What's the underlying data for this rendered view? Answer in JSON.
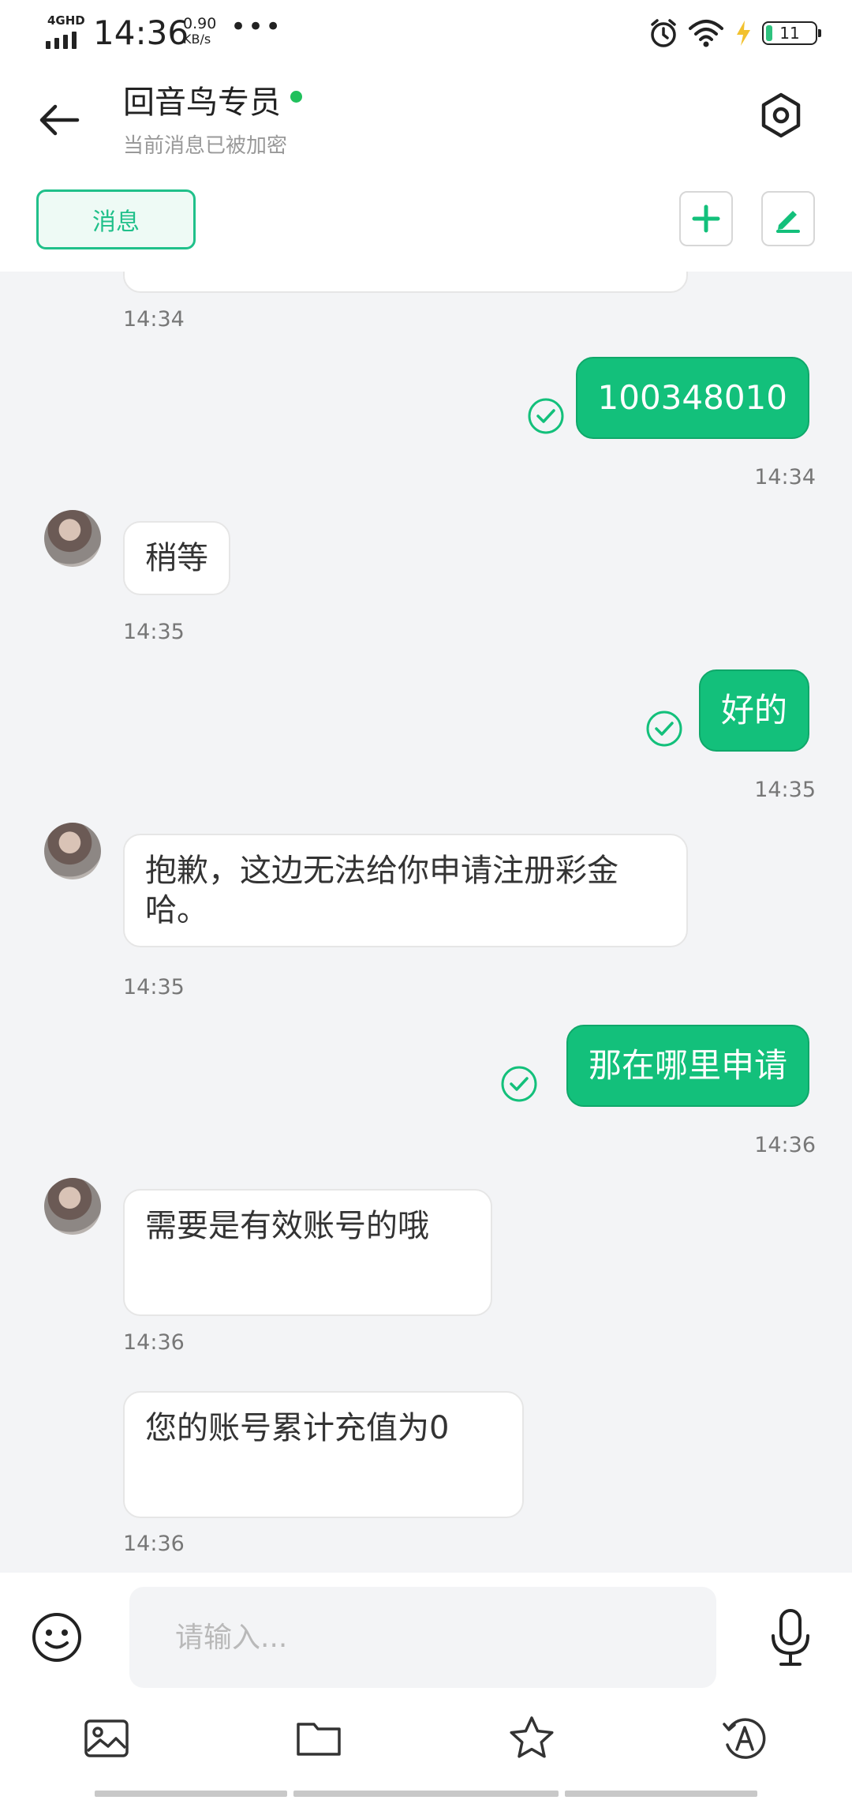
{
  "status_bar": {
    "network": "4GHD",
    "time": "14:36",
    "speed_value": "0.90",
    "speed_unit": "KB/s",
    "more": "•••",
    "battery": "11"
  },
  "header": {
    "title": "回音鸟专员",
    "subtitle": "当前消息已被加密",
    "tab_label": "消息",
    "online_color": "#20c05c"
  },
  "chat": {
    "messages": [
      {
        "side": "in",
        "text": "",
        "time": "14:34"
      },
      {
        "side": "out",
        "text": "100348010",
        "time": "14:34"
      },
      {
        "side": "in",
        "text": "稍等",
        "time": "14:35"
      },
      {
        "side": "out",
        "text": "好的",
        "time": "14:35"
      },
      {
        "side": "in",
        "text": "抱歉，这边无法给你申请注册彩金哈。",
        "time": "14:35"
      },
      {
        "side": "out",
        "text": "那在哪里申请",
        "time": "14:36"
      },
      {
        "side": "in",
        "text": "需要是有效账号的哦",
        "time": "14:36"
      },
      {
        "side": "in",
        "text": "您的账号累计充值为0",
        "time": "14:36"
      }
    ]
  },
  "input": {
    "placeholder": "请输入..."
  },
  "icons": {
    "back": "arrow-left-icon",
    "settings": "hexagon-settings-icon",
    "add": "plus-icon",
    "edit": "pen-icon",
    "emoji": "smile-icon",
    "mic": "microphone-icon",
    "image": "image-icon",
    "folder": "folder-icon",
    "star": "star-icon",
    "translate": "auto-translate-icon"
  },
  "colors": {
    "accent": "#13c07b",
    "accent_border": "#20c08a"
  }
}
